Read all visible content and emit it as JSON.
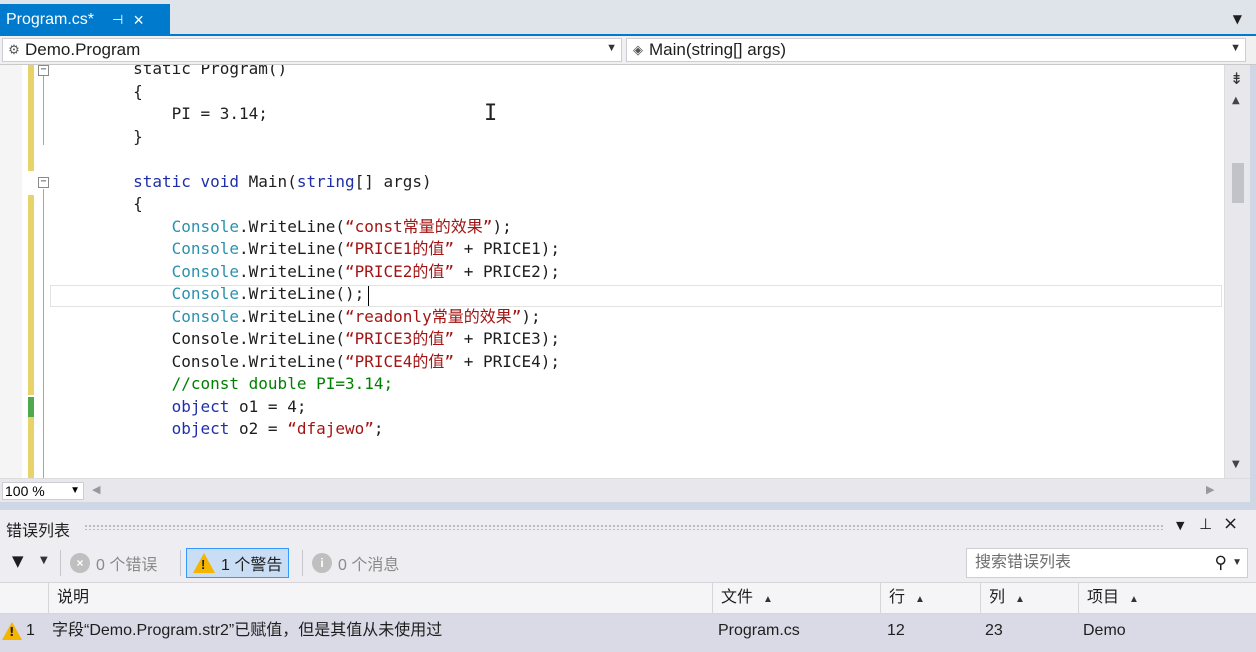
{
  "tab": {
    "title": "Program.cs*",
    "pin_icon": "pin-icon",
    "close_icon": "close-icon"
  },
  "navbar": {
    "type_combo": "Demo.Program",
    "member_combo": "Main(string[] args)"
  },
  "editor": {
    "lines": [
      {
        "indent": "        ",
        "tokens": [
          {
            "t": "static Program()",
            "c": ""
          }
        ]
      },
      {
        "indent": "        ",
        "tokens": [
          {
            "t": "{",
            "c": ""
          }
        ]
      },
      {
        "indent": "            ",
        "tokens": [
          {
            "t": "PI = 3.14;",
            "c": ""
          }
        ]
      },
      {
        "indent": "        ",
        "tokens": [
          {
            "t": "}",
            "c": ""
          }
        ]
      },
      {
        "indent": "",
        "tokens": []
      },
      {
        "indent": "        ",
        "tokens": [
          {
            "t": "static void ",
            "c": "kw"
          },
          {
            "t": "Main(",
            "c": ""
          },
          {
            "t": "string",
            "c": "kw"
          },
          {
            "t": "[] args)",
            "c": ""
          }
        ]
      },
      {
        "indent": "        ",
        "tokens": [
          {
            "t": "{",
            "c": ""
          }
        ]
      },
      {
        "indent": "            ",
        "tokens": [
          {
            "t": "Console",
            "c": "ty"
          },
          {
            "t": ".WriteLine(",
            "c": ""
          },
          {
            "t": "“const常量的效果”",
            "c": "str"
          },
          {
            "t": ");",
            "c": ""
          }
        ]
      },
      {
        "indent": "            ",
        "tokens": [
          {
            "t": "Console",
            "c": "ty"
          },
          {
            "t": ".WriteLine(",
            "c": ""
          },
          {
            "t": "“PRICE1的值”",
            "c": "str"
          },
          {
            "t": " + PRICE1);",
            "c": ""
          }
        ]
      },
      {
        "indent": "            ",
        "tokens": [
          {
            "t": "Console",
            "c": "ty"
          },
          {
            "t": ".WriteLine(",
            "c": ""
          },
          {
            "t": "“PRICE2的值”",
            "c": "str"
          },
          {
            "t": " + PRICE2);",
            "c": ""
          }
        ]
      },
      {
        "indent": "            ",
        "tokens": [
          {
            "t": "Console",
            "c": "ty"
          },
          {
            "t": ".WriteLine();",
            "c": ""
          }
        ]
      },
      {
        "indent": "            ",
        "tokens": [
          {
            "t": "Console",
            "c": "ty"
          },
          {
            "t": ".WriteLine(",
            "c": ""
          },
          {
            "t": "“readonly常量的效果”",
            "c": "str"
          },
          {
            "t": ");",
            "c": ""
          }
        ]
      },
      {
        "indent": "            ",
        "tokens": [
          {
            "t": "Console.WriteLine(",
            "c": ""
          },
          {
            "t": "“PRICE3的值”",
            "c": "str"
          },
          {
            "t": " + PRICE3);",
            "c": ""
          }
        ]
      },
      {
        "indent": "            ",
        "tokens": [
          {
            "t": "Console.WriteLine(",
            "c": ""
          },
          {
            "t": "“PRICE4的值”",
            "c": "str"
          },
          {
            "t": " + PRICE4);",
            "c": ""
          }
        ]
      },
      {
        "indent": "            ",
        "tokens": [
          {
            "t": "//const double PI=3.14;",
            "c": "cm"
          }
        ]
      },
      {
        "indent": "            ",
        "tokens": [
          {
            "t": "object",
            "c": "kw"
          },
          {
            "t": " o1 = 4;",
            "c": ""
          }
        ]
      },
      {
        "indent": "            ",
        "tokens": [
          {
            "t": "object",
            "c": "kw"
          },
          {
            "t": " o2 = ",
            "c": ""
          },
          {
            "t": "“dfajewo”",
            "c": "str"
          },
          {
            "t": ";",
            "c": ""
          }
        ]
      }
    ]
  },
  "zoom": {
    "value": "100 %"
  },
  "error_list": {
    "title": "错误列表",
    "errors_btn": "0 个错误",
    "warnings_btn": "1 个警告",
    "messages_btn": "0 个消息",
    "search_placeholder": "搜索错误列表",
    "columns": {
      "description": "说明",
      "file": "文件",
      "line": "行",
      "column": "列",
      "project": "项目"
    },
    "rows": [
      {
        "index": "1",
        "description": "字段“Demo.Program.str2”已赋值，但是其值从未使用过",
        "file": "Program.cs",
        "line": "12",
        "column": "23",
        "project": "Demo"
      }
    ]
  },
  "colors": {
    "accent": "#007acc",
    "keyword": "#1f2fa8",
    "type": "#2b91af",
    "string": "#a31515",
    "comment": "#008000",
    "warning": "#f4b400"
  }
}
